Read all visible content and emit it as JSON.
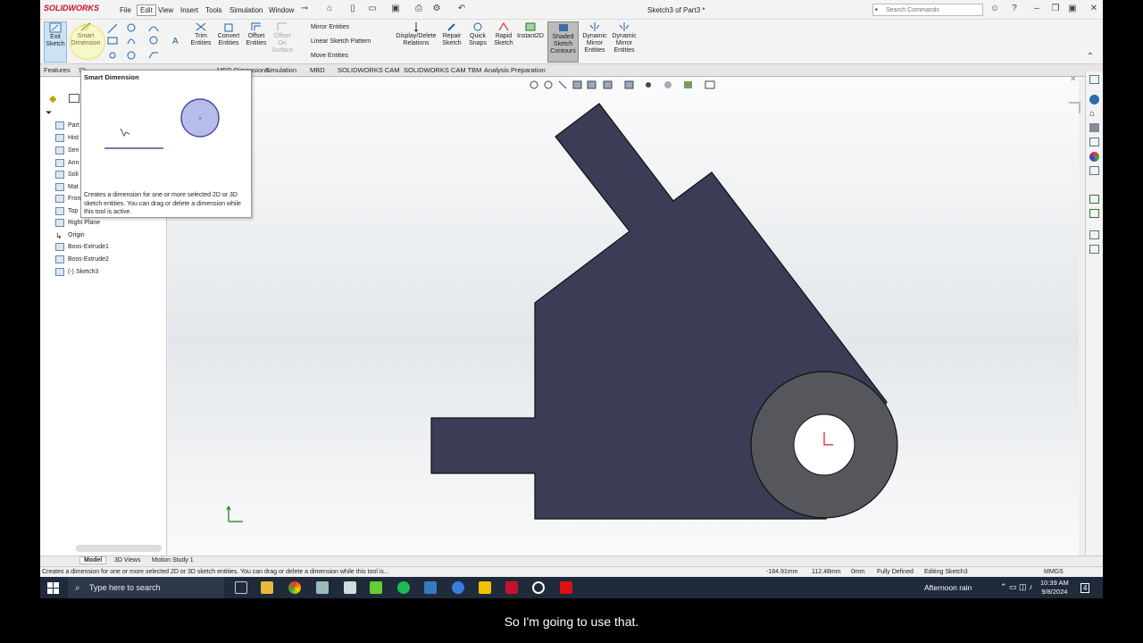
{
  "app": {
    "logo": "SOLIDWORKS",
    "document_title": "Sketch3 of Part3 *"
  },
  "menu": [
    "File",
    "Edit",
    "View",
    "Insert",
    "Tools",
    "Simulation",
    "Window"
  ],
  "search": {
    "placeholder": "Search Commands"
  },
  "ribbon": {
    "exit_sketch": "Exit Sketch",
    "smart_dimension": "Smart Dimension",
    "trim_entities": "Trim Entities",
    "convert_entities": "Convert Entities",
    "offset_entities": "Offset Entities",
    "offset_on_surface": "Offset On Surface",
    "mirror_entities": "Mirror Entities",
    "linear_sketch_pattern": "Linear Sketch Pattern",
    "move_entities": "Move Entities",
    "display_delete_relations": "Display/Delete Relations",
    "repair_sketch": "Repair Sketch",
    "quick_snaps": "Quick Snaps",
    "rapid_sketch": "Rapid Sketch",
    "instant2d": "Instant2D",
    "shaded_sketch_contours": "Shaded Sketch Contours",
    "dynamic_mirror_entities_1": "Dynamic Mirror Entities",
    "dynamic_mirror_entities_2": "Dynamic Mirror Entities"
  },
  "tabs": [
    "Features",
    "Sk",
    "",
    "",
    "",
    "MBD Dimensions",
    "Simulation",
    "MBD",
    "SOLIDWORKS CAM",
    "SOLIDWORKS CAM TBM",
    "Analysis Preparation"
  ],
  "tree": {
    "items": [
      "Part",
      "Hist",
      "Sen",
      "Ann",
      "Soli",
      "Mat",
      "Fron",
      "Top",
      "Right Plane",
      "Origin",
      "Boss-Extrude1",
      "Boss-Extrude2",
      "(-) Sketch3"
    ]
  },
  "tooltip": {
    "title": "Smart Dimension",
    "description": "Creates a dimension for one or more selected 2D or 3D sketch entities. You can drag or delete a dimension while this tool is active."
  },
  "bottom_tabs": [
    "Model",
    "3D Views",
    "Motion Study 1"
  ],
  "status": {
    "message": "Creates a dimension for one or more selected 2D or 3D sketch entities. You can drag or delete a dimension while this tool is...",
    "x": "-184.91mm",
    "y": "112.48mm",
    "z": "0mm",
    "state": "Fully Defined",
    "editing": "Editing Sketch3",
    "units": "MMGS"
  },
  "taskbar": {
    "search_placeholder": "Type here to search",
    "weather": "Afternoon rain",
    "time": "10:39 AM",
    "date": "9/8/2024",
    "notifications": "4"
  },
  "caption": "So I'm going to use that.",
  "colors": {
    "sketch_fill": "#3b3d56",
    "ring_fill": "#55575d",
    "accent": "#c8102e"
  }
}
